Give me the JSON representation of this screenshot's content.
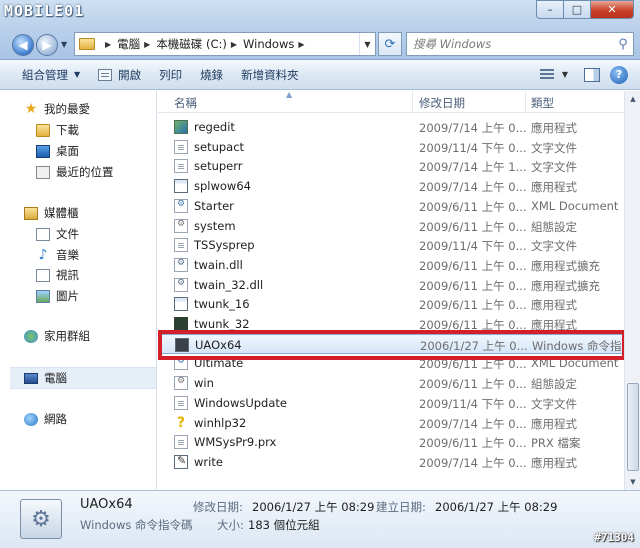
{
  "watermark_top": "MOBILE01",
  "watermark_bottom": "#71304",
  "window": {
    "min": "–",
    "max": "□",
    "close": "✕"
  },
  "address": {
    "crumbs": [
      "電腦",
      "本機磁碟 (C:)",
      "Windows"
    ],
    "search_placeholder": "搜尋 Windows"
  },
  "toolbar": {
    "organize": "組合管理",
    "open": "開啟",
    "print": "列印",
    "burn": "燒錄",
    "new_folder": "新增資料夾"
  },
  "nav": {
    "favorites": "我的最愛",
    "downloads": "下載",
    "desktop": "桌面",
    "recent": "最近的位置",
    "libraries": "媒體櫃",
    "documents": "文件",
    "music": "音樂",
    "videos": "視訊",
    "pictures": "圖片",
    "homegroup": "家用群組",
    "computer": "電腦",
    "network": "網路"
  },
  "columns": {
    "name": "名稱",
    "date": "修改日期",
    "type": "類型"
  },
  "files": [
    {
      "name": "regedit",
      "date": "2009/7/14 上午 0...",
      "type": "應用程式",
      "icon": "regedit-icon"
    },
    {
      "name": "setupact",
      "date": "2009/11/4 下午 0...",
      "type": "文字文件",
      "icon": "text-file-icon"
    },
    {
      "name": "setuperr",
      "date": "2009/7/14 上午 1...",
      "type": "文字文件",
      "icon": "text-file-icon"
    },
    {
      "name": "splwow64",
      "date": "2009/7/14 上午 0...",
      "type": "應用程式",
      "icon": "exe-icon"
    },
    {
      "name": "Starter",
      "date": "2009/6/11 上午 0...",
      "type": "XML Document",
      "icon": "xml-icon"
    },
    {
      "name": "system",
      "date": "2009/6/11 上午 0...",
      "type": "組態設定",
      "icon": "ini-icon"
    },
    {
      "name": "TSSysprep",
      "date": "2009/11/4 下午 0...",
      "type": "文字文件",
      "icon": "text-file-icon"
    },
    {
      "name": "twain.dll",
      "date": "2009/6/11 上午 0...",
      "type": "應用程式擴充",
      "icon": "dll-icon"
    },
    {
      "name": "twain_32.dll",
      "date": "2009/6/11 上午 0...",
      "type": "應用程式擴充",
      "icon": "dll-icon"
    },
    {
      "name": "twunk_16",
      "date": "2009/6/11 上午 0...",
      "type": "應用程式",
      "icon": "exe-icon"
    },
    {
      "name": "twunk_32",
      "date": "2009/6/11 上午 0...",
      "type": "應用程式",
      "icon": "exe-dark-icon"
    },
    {
      "name": "UAOx64",
      "date": "2006/1/27 上午 0...",
      "type": "Windows 命令指",
      "icon": "cmd-file-icon",
      "selected": true
    },
    {
      "name": "Ultimate",
      "date": "2009/6/11 上午 0...",
      "type": "XML Document",
      "icon": "xml-icon"
    },
    {
      "name": "win",
      "date": "2009/6/11 上午 0...",
      "type": "組態設定",
      "icon": "ini-icon"
    },
    {
      "name": "WindowsUpdate",
      "date": "2009/11/4 下午 0...",
      "type": "文字文件",
      "icon": "text-file-icon"
    },
    {
      "name": "winhlp32",
      "date": "2009/7/14 上午 0...",
      "type": "應用程式",
      "icon": "help-icon"
    },
    {
      "name": "WMSysPr9.prx",
      "date": "2009/6/11 上午 0...",
      "type": "PRX 檔案",
      "icon": "text-file-icon"
    },
    {
      "name": "write",
      "date": "2009/7/14 上午 0...",
      "type": "應用程式",
      "icon": "write-icon"
    }
  ],
  "details": {
    "name": "UAOx64",
    "type": "Windows 命令指令碼",
    "modified_label": "修改日期:",
    "modified": "2006/1/27 上午 08:29",
    "created_label": "建立日期:",
    "created": "2006/1/27 上午 08:29",
    "size_label": "大小:",
    "size": "183 個位元組"
  }
}
